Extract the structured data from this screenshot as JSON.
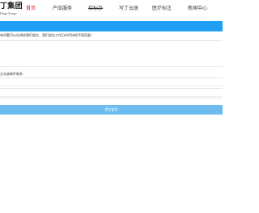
{
  "logo": {
    "main": "丁集团",
    "sub": "Ding Group"
  },
  "nav": [
    {
      "label": "首页"
    },
    {
      "label": "产品服务"
    },
    {
      "label": "招标办"
    },
    {
      "label": "写丁云居"
    },
    {
      "label": "医疗标注"
    },
    {
      "label": "新闻中心"
    }
  ],
  "colors": {
    "banner": "#1e9ff4",
    "submit": "#6cbcf0",
    "active_nav": "#c61f1f"
  },
  "form": {
    "note": "有问题可以在线给我们留言，我们会在工作日内尽快给予您回复！",
    "contact_label": "方式或邮件联系",
    "submit_label": "提交留言"
  }
}
